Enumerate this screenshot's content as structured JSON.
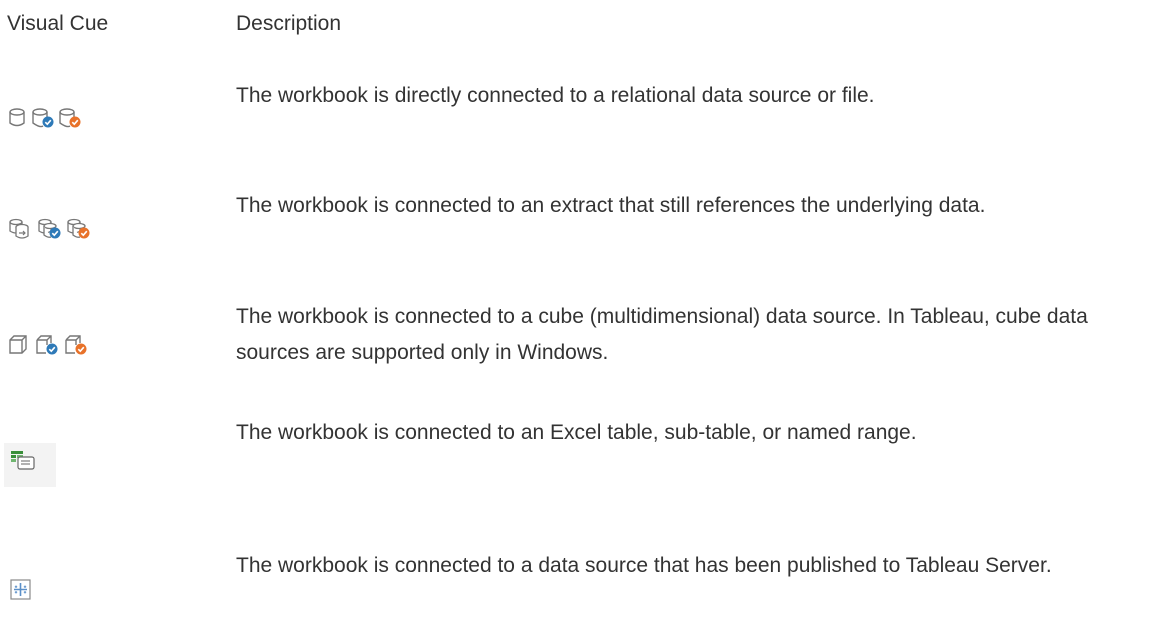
{
  "header": {
    "visual_cue": "Visual Cue",
    "description": "Description"
  },
  "rows": [
    {
      "description": "The workbook is directly connected to a relational data source or file.",
      "icons": [
        "database-icon",
        "database-check-blue-icon",
        "database-check-orange-icon"
      ]
    },
    {
      "description": "The workbook is connected to an extract that still references the underlying data.",
      "icons": [
        "extract-icon",
        "extract-check-blue-icon",
        "extract-check-orange-icon"
      ]
    },
    {
      "description": "The workbook is connected to a cube (multidimensional) data source. In Tableau, cube data sources are supported only in Windows.",
      "icons": [
        "cube-icon",
        "cube-check-blue-icon",
        "cube-check-orange-icon"
      ]
    },
    {
      "description": "The workbook is connected to an Excel table, sub-table, or named range.",
      "icons": [
        "excel-table-icon"
      ]
    },
    {
      "description": "The workbook is connected to a data source that has been published to Tableau Server.",
      "icons": [
        "tableau-server-icon"
      ]
    }
  ],
  "colors": {
    "text": "#333333",
    "icon_stroke": "#777777",
    "badge_blue": "#2e7ab8",
    "badge_orange": "#e8722a",
    "excel_green": "#3a8f3a",
    "server_blue": "#5b8fc8"
  }
}
